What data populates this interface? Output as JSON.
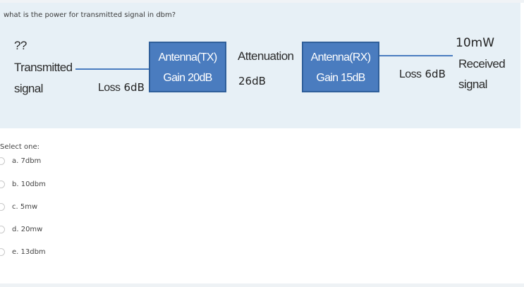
{
  "question": "what is the power for transmitted signal in dbm?",
  "diagram": {
    "tx": {
      "unknown": "??",
      "line1": "Transmitted",
      "line2": "signal"
    },
    "loss_left": {
      "word": "Loss",
      "value": "6dB"
    },
    "antenna_tx": {
      "line1": "Antenna(TX)",
      "line2": "Gain 20dB"
    },
    "attenuation": {
      "label": "Attenuation",
      "value": "26dB"
    },
    "antenna_rx": {
      "line1": "Antenna(RX)",
      "line2": "Gain 15dB"
    },
    "loss_right": {
      "word": "Loss",
      "value": "6dB"
    },
    "rx": {
      "power": "10mW",
      "line1": "Received",
      "line2": "signal"
    },
    "colors": {
      "box": "#4a7cbf",
      "panel": "#e7f0f6"
    }
  },
  "select_label": "Select one:",
  "options": [
    {
      "label": "a. 7dbm"
    },
    {
      "label": "b. 10dbm"
    },
    {
      "label": "c. 5mw"
    },
    {
      "label": "d. 20mw"
    },
    {
      "label": "e. 13dbm"
    }
  ]
}
